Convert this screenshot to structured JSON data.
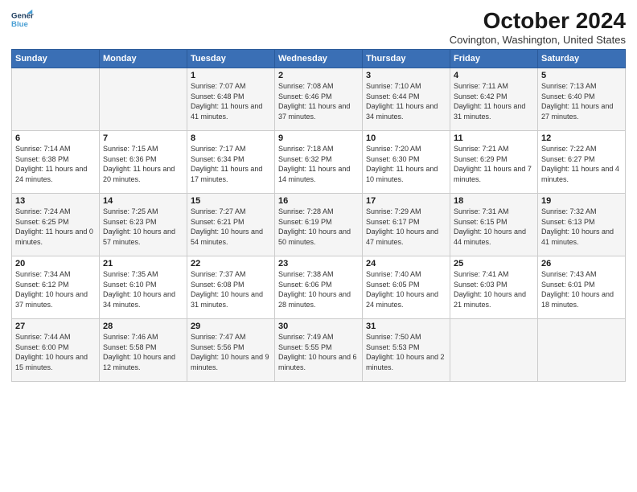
{
  "header": {
    "logo_line1": "General",
    "logo_line2": "Blue",
    "title": "October 2024",
    "subtitle": "Covington, Washington, United States"
  },
  "days_of_week": [
    "Sunday",
    "Monday",
    "Tuesday",
    "Wednesday",
    "Thursday",
    "Friday",
    "Saturday"
  ],
  "weeks": [
    [
      {
        "day": "",
        "info": ""
      },
      {
        "day": "",
        "info": ""
      },
      {
        "day": "1",
        "info": "Sunrise: 7:07 AM\nSunset: 6:48 PM\nDaylight: 11 hours and 41 minutes."
      },
      {
        "day": "2",
        "info": "Sunrise: 7:08 AM\nSunset: 6:46 PM\nDaylight: 11 hours and 37 minutes."
      },
      {
        "day": "3",
        "info": "Sunrise: 7:10 AM\nSunset: 6:44 PM\nDaylight: 11 hours and 34 minutes."
      },
      {
        "day": "4",
        "info": "Sunrise: 7:11 AM\nSunset: 6:42 PM\nDaylight: 11 hours and 31 minutes."
      },
      {
        "day": "5",
        "info": "Sunrise: 7:13 AM\nSunset: 6:40 PM\nDaylight: 11 hours and 27 minutes."
      }
    ],
    [
      {
        "day": "6",
        "info": "Sunrise: 7:14 AM\nSunset: 6:38 PM\nDaylight: 11 hours and 24 minutes."
      },
      {
        "day": "7",
        "info": "Sunrise: 7:15 AM\nSunset: 6:36 PM\nDaylight: 11 hours and 20 minutes."
      },
      {
        "day": "8",
        "info": "Sunrise: 7:17 AM\nSunset: 6:34 PM\nDaylight: 11 hours and 17 minutes."
      },
      {
        "day": "9",
        "info": "Sunrise: 7:18 AM\nSunset: 6:32 PM\nDaylight: 11 hours and 14 minutes."
      },
      {
        "day": "10",
        "info": "Sunrise: 7:20 AM\nSunset: 6:30 PM\nDaylight: 11 hours and 10 minutes."
      },
      {
        "day": "11",
        "info": "Sunrise: 7:21 AM\nSunset: 6:29 PM\nDaylight: 11 hours and 7 minutes."
      },
      {
        "day": "12",
        "info": "Sunrise: 7:22 AM\nSunset: 6:27 PM\nDaylight: 11 hours and 4 minutes."
      }
    ],
    [
      {
        "day": "13",
        "info": "Sunrise: 7:24 AM\nSunset: 6:25 PM\nDaylight: 11 hours and 0 minutes."
      },
      {
        "day": "14",
        "info": "Sunrise: 7:25 AM\nSunset: 6:23 PM\nDaylight: 10 hours and 57 minutes."
      },
      {
        "day": "15",
        "info": "Sunrise: 7:27 AM\nSunset: 6:21 PM\nDaylight: 10 hours and 54 minutes."
      },
      {
        "day": "16",
        "info": "Sunrise: 7:28 AM\nSunset: 6:19 PM\nDaylight: 10 hours and 50 minutes."
      },
      {
        "day": "17",
        "info": "Sunrise: 7:29 AM\nSunset: 6:17 PM\nDaylight: 10 hours and 47 minutes."
      },
      {
        "day": "18",
        "info": "Sunrise: 7:31 AM\nSunset: 6:15 PM\nDaylight: 10 hours and 44 minutes."
      },
      {
        "day": "19",
        "info": "Sunrise: 7:32 AM\nSunset: 6:13 PM\nDaylight: 10 hours and 41 minutes."
      }
    ],
    [
      {
        "day": "20",
        "info": "Sunrise: 7:34 AM\nSunset: 6:12 PM\nDaylight: 10 hours and 37 minutes."
      },
      {
        "day": "21",
        "info": "Sunrise: 7:35 AM\nSunset: 6:10 PM\nDaylight: 10 hours and 34 minutes."
      },
      {
        "day": "22",
        "info": "Sunrise: 7:37 AM\nSunset: 6:08 PM\nDaylight: 10 hours and 31 minutes."
      },
      {
        "day": "23",
        "info": "Sunrise: 7:38 AM\nSunset: 6:06 PM\nDaylight: 10 hours and 28 minutes."
      },
      {
        "day": "24",
        "info": "Sunrise: 7:40 AM\nSunset: 6:05 PM\nDaylight: 10 hours and 24 minutes."
      },
      {
        "day": "25",
        "info": "Sunrise: 7:41 AM\nSunset: 6:03 PM\nDaylight: 10 hours and 21 minutes."
      },
      {
        "day": "26",
        "info": "Sunrise: 7:43 AM\nSunset: 6:01 PM\nDaylight: 10 hours and 18 minutes."
      }
    ],
    [
      {
        "day": "27",
        "info": "Sunrise: 7:44 AM\nSunset: 6:00 PM\nDaylight: 10 hours and 15 minutes."
      },
      {
        "day": "28",
        "info": "Sunrise: 7:46 AM\nSunset: 5:58 PM\nDaylight: 10 hours and 12 minutes."
      },
      {
        "day": "29",
        "info": "Sunrise: 7:47 AM\nSunset: 5:56 PM\nDaylight: 10 hours and 9 minutes."
      },
      {
        "day": "30",
        "info": "Sunrise: 7:49 AM\nSunset: 5:55 PM\nDaylight: 10 hours and 6 minutes."
      },
      {
        "day": "31",
        "info": "Sunrise: 7:50 AM\nSunset: 5:53 PM\nDaylight: 10 hours and 2 minutes."
      },
      {
        "day": "",
        "info": ""
      },
      {
        "day": "",
        "info": ""
      }
    ]
  ]
}
